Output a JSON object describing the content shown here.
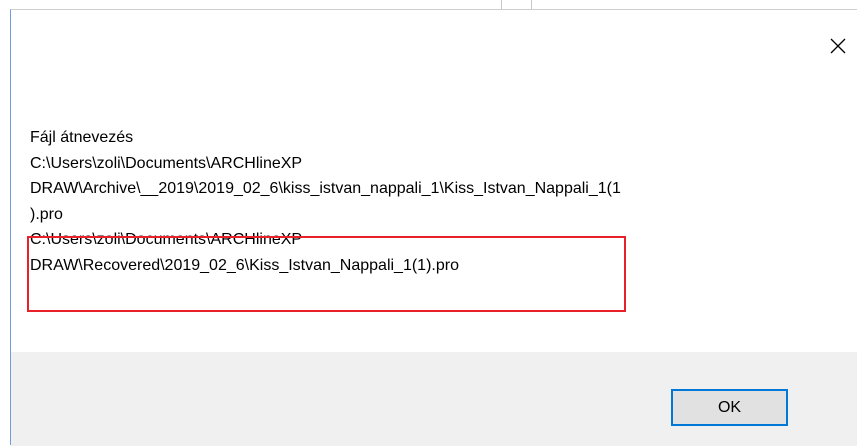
{
  "dialog": {
    "close_icon": "close-icon",
    "message_lines": [
      "Fájl átnevezés",
      "C:\\Users\\zoli\\Documents\\ARCHlineXP",
      "DRAW\\Archive\\__2019\\2019_02_6\\kiss_istvan_nappali_1\\Kiss_Istvan_Nappali_1(1",
      ").pro",
      "C:\\Users\\zoli\\Documents\\ARCHlineXP",
      "DRAW\\Recovered\\2019_02_6\\Kiss_Istvan_Nappali_1(1).pro"
    ],
    "highlight_color": "#e8202a",
    "ok_label": "OK",
    "accent_color": "#0078d7"
  }
}
